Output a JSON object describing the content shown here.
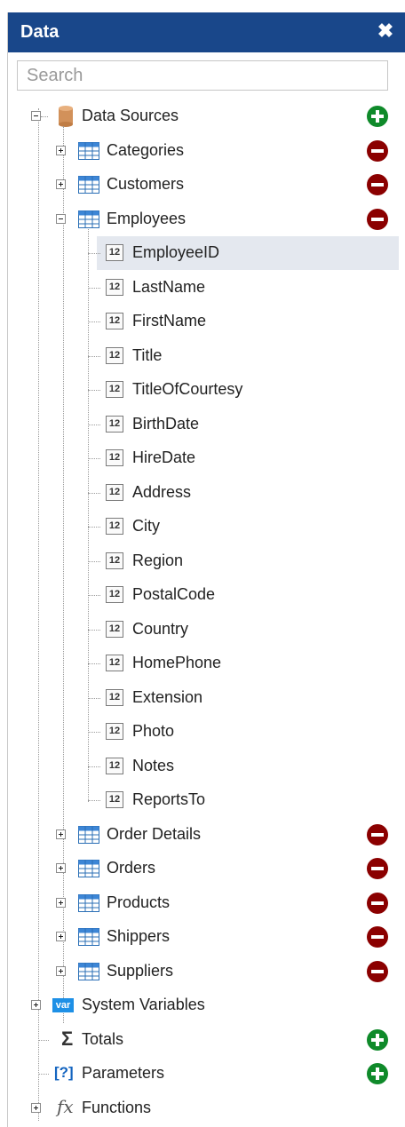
{
  "panel": {
    "title": "Data",
    "close_glyph": "✖"
  },
  "search": {
    "placeholder": "Search",
    "value": ""
  },
  "tree": {
    "data_sources": {
      "label": "Data Sources"
    },
    "tables": [
      {
        "label": "Categories"
      },
      {
        "label": "Customers"
      },
      {
        "label": "Employees"
      }
    ],
    "employee_fields": [
      "EmployeeID",
      "LastName",
      "FirstName",
      "Title",
      "TitleOfCourtesy",
      "BirthDate",
      "HireDate",
      "Address",
      "City",
      "Region",
      "PostalCode",
      "Country",
      "HomePhone",
      "Extension",
      "Photo",
      "Notes",
      "ReportsTo"
    ],
    "more_tables": [
      {
        "label": "Order Details"
      },
      {
        "label": "Orders"
      },
      {
        "label": "Products"
      },
      {
        "label": "Shippers"
      },
      {
        "label": "Suppliers"
      }
    ],
    "system_variables": {
      "label": "System Variables",
      "badge": "var"
    },
    "totals": {
      "label": "Totals",
      "glyph": "Σ"
    },
    "parameters": {
      "label": "Parameters",
      "glyph": "[?]"
    },
    "functions": {
      "label": "Functions",
      "glyph": "fx"
    },
    "field_type_glyph": "12"
  },
  "colors": {
    "titlebar": "#19478a",
    "add": "#0f8a2a",
    "remove": "#8b0000",
    "selected_row": "#e4e8ef"
  }
}
